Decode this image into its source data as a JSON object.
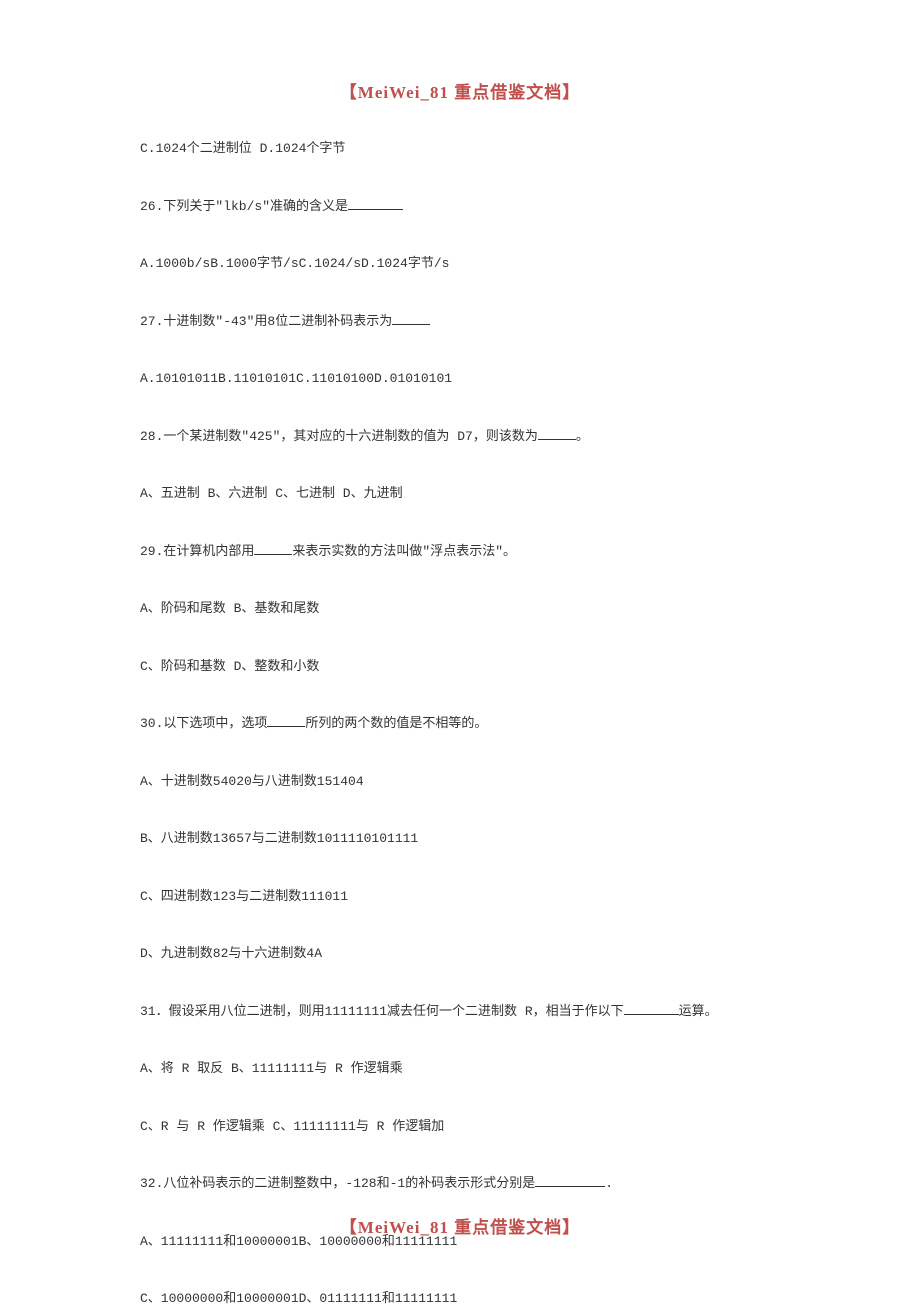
{
  "header": "【MeiWei_81 重点借鉴文档】",
  "footer": "【MeiWei_81 重点借鉴文档】",
  "lines": {
    "l1": "C.1024个二进制位 D.1024个字节",
    "l2a": "26.下列关于\"lkb/s\"准确的含义是",
    "l3": "A.1000b/sB.1000字节/sC.1024/sD.1024字节/s",
    "l4a": "27.十进制数\"-43\"用8位二进制补码表示为",
    "l5": "A.10101011B.11010101C.11010100D.01010101",
    "l6a": "28.一个某进制数\"425\"，其对应的十六进制数的值为 D7，则该数为",
    "l6b": "。",
    "l7": "A、五进制 B、六进制 C、七进制 D、九进制",
    "l8a": "29.在计算机内部用",
    "l8b": "来表示实数的方法叫做\"浮点表示法\"。",
    "l9": "A、阶码和尾数 B、基数和尾数",
    "l10": "C、阶码和基数 D、整数和小数",
    "l11a": "30.以下选项中，选项",
    "l11b": "所列的两个数的值是不相等的。",
    "l12": "A、十进制数54020与八进制数151404",
    "l13": "B、八进制数13657与二进制数1011110101111",
    "l14": "C、四进制数123与二进制数111011",
    "l15": "D、九进制数82与十六进制数4A",
    "l16a": "31．假设采用八位二进制，则用11111111减去任何一个二进制数 R，相当于作以下",
    "l16b": "运算。",
    "l17": "A、将 R 取反 B、11111111与 R 作逻辑乘",
    "l18": "C、R 与 R 作逻辑乘 C、11111111与 R 作逻辑加",
    "l19a": "32.八位补码表示的二进制整数中，-128和-1的补码表示形式分别是",
    "l19b": ".",
    "l20": "A、11111111和10000001B、10000000和11111111",
    "l21": "C、10000000和10000001D、01111111和11111111"
  }
}
